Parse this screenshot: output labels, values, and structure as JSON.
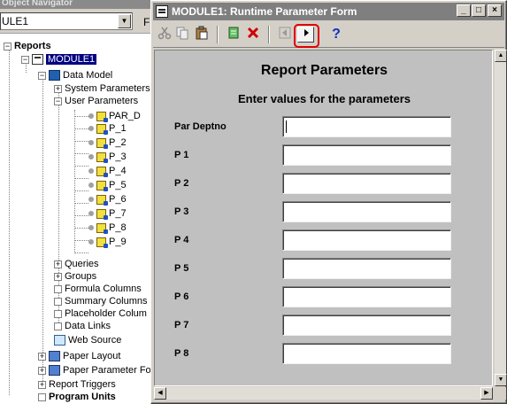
{
  "navigator": {
    "title": "Object Navigator",
    "module_select": "ULE1",
    "toolbar_f": "F",
    "tree": [
      {
        "label": "Reports",
        "bold": true
      },
      {
        "label": "MODULE1",
        "selected": true
      },
      {
        "label": "Data Model"
      },
      {
        "label": "System Parameters"
      },
      {
        "label": "User Parameters"
      },
      {
        "label": "PAR_D"
      },
      {
        "label": "P_1"
      },
      {
        "label": "P_2"
      },
      {
        "label": "P_3"
      },
      {
        "label": "P_4"
      },
      {
        "label": "P_5"
      },
      {
        "label": "P_6"
      },
      {
        "label": "P_7"
      },
      {
        "label": "P_8"
      },
      {
        "label": "P_9"
      },
      {
        "label": "Queries"
      },
      {
        "label": "Groups"
      },
      {
        "label": "Formula Columns"
      },
      {
        "label": "Summary Columns"
      },
      {
        "label": "Placeholder Colum"
      },
      {
        "label": "Data Links"
      },
      {
        "label": "Web Source"
      },
      {
        "label": "Paper Layout"
      },
      {
        "label": "Paper Parameter Fo"
      },
      {
        "label": "Report Triggers"
      },
      {
        "label": "Program Units",
        "bold": true
      }
    ]
  },
  "window": {
    "title": "MODULE1: Runtime Parameter Form",
    "buttons": {
      "minimize": "_",
      "maximize": "□",
      "close": "×"
    },
    "toolbar": {
      "icons": [
        "cut-icon",
        "copy-icon",
        "paste-icon",
        "validate-icon",
        "cancel-icon",
        "previous-icon",
        "run-report-icon",
        "help-icon"
      ],
      "help_glyph": "?"
    }
  },
  "form": {
    "title": "Report Parameters",
    "subtitle": "Enter values for the parameters",
    "parameters": [
      {
        "label": "Par Deptno",
        "value": ""
      },
      {
        "label": "P 1",
        "value": ""
      },
      {
        "label": "P 2",
        "value": ""
      },
      {
        "label": "P 3",
        "value": ""
      },
      {
        "label": "P 4",
        "value": ""
      },
      {
        "label": "P 5",
        "value": ""
      },
      {
        "label": "P 6",
        "value": ""
      },
      {
        "label": "P 7",
        "value": ""
      },
      {
        "label": "P 8",
        "value": ""
      }
    ]
  },
  "colors": {
    "titlebar": "#7f7f7f",
    "form_background": "#c0c0c0",
    "highlight_ring": "#e00000",
    "cancel_x": "#d00000",
    "help": "#1030c0"
  }
}
